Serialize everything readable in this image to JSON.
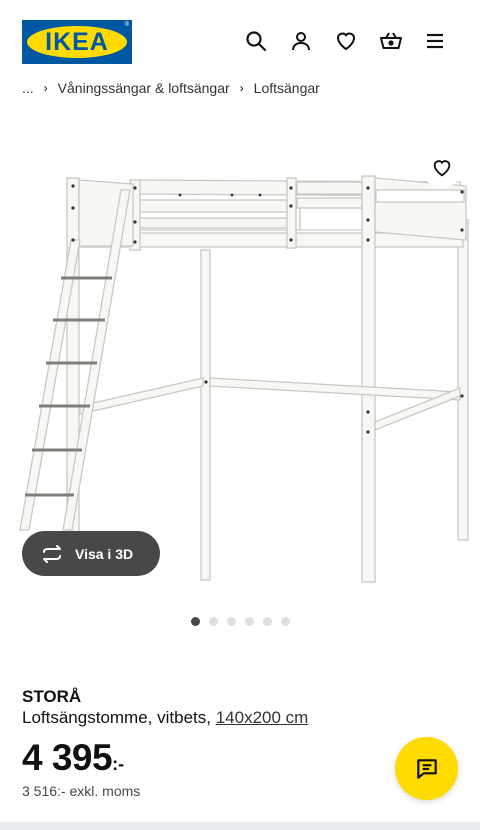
{
  "header": {
    "logo_text": "IKEA",
    "icons": [
      "search-icon",
      "user-icon",
      "heart-icon",
      "basket-icon",
      "menu-icon"
    ]
  },
  "breadcrumb": {
    "ellipsis": "...",
    "items": [
      "Våningssängar & loftsängar",
      "Loftsängar"
    ]
  },
  "gallery": {
    "view3d_label": "Visa i 3D",
    "image_count": 6,
    "active_index": 0
  },
  "product": {
    "name": "STORÅ",
    "description": "Loftsängstomme, vitbets,",
    "size_link": "140x200 cm",
    "price_amount": "4 395",
    "price_suffix": ":-",
    "price_ex_vat": "3 516:- exkl. moms"
  },
  "colors": {
    "ikea_blue": "#0058a3",
    "ikea_yellow": "#ffdb00",
    "dark_button": "#484848",
    "dot_inactive": "#dfdfdf"
  }
}
